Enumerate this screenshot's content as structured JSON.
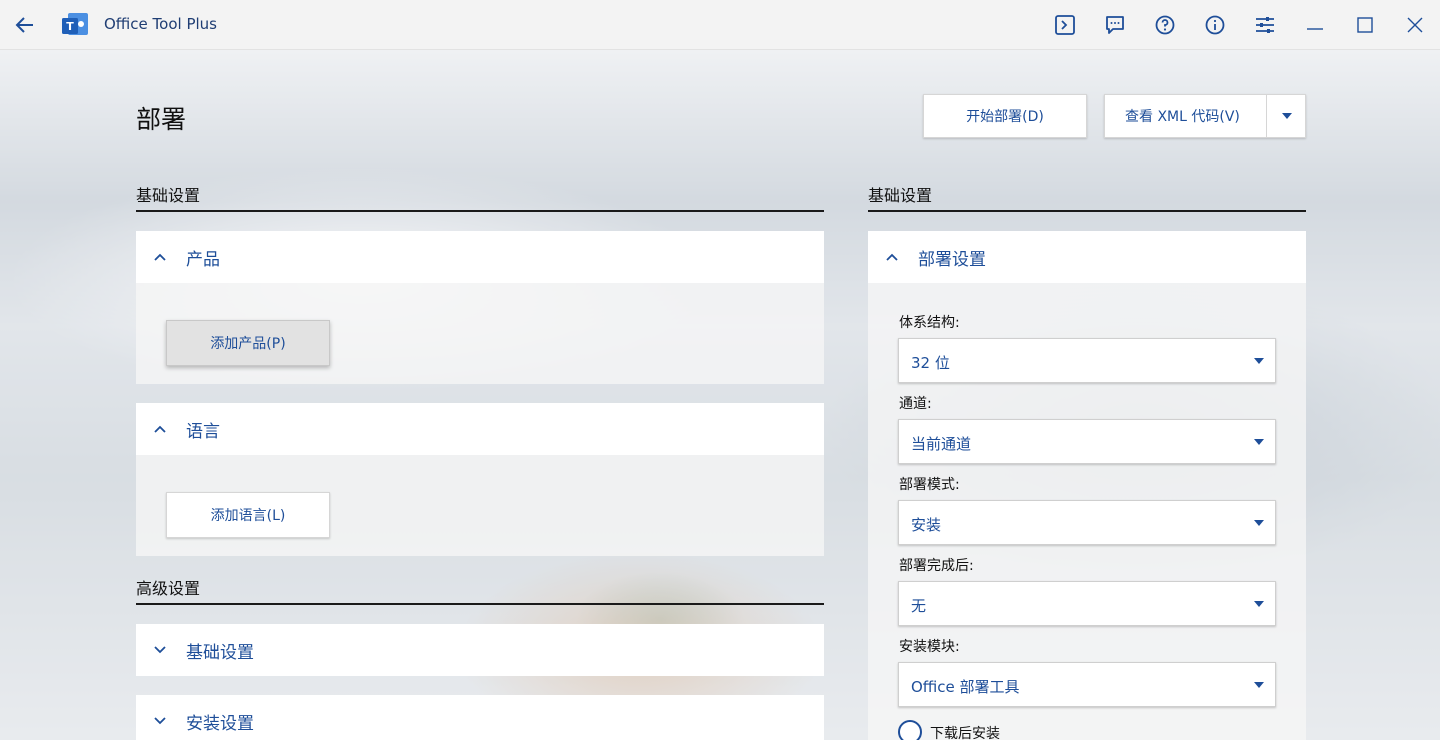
{
  "app": {
    "title": "Office Tool Plus"
  },
  "page": {
    "title": "部署"
  },
  "toolbar": {
    "start_deploy": "开始部署(D)",
    "view_xml": "查看 XML 代码(V)"
  },
  "left": {
    "basic_section": "基础设置",
    "advanced_section": "高级设置",
    "product_panel": {
      "title": "产品",
      "add_button": "添加产品(P)"
    },
    "language_panel": {
      "title": "语言",
      "add_button": "添加语言(L)"
    },
    "advanced_panels": [
      "基础设置",
      "安装设置"
    ]
  },
  "right": {
    "section": "基础设置",
    "panel_title": "部署设置",
    "fields": [
      {
        "label": "体系结构:",
        "value": "32 位"
      },
      {
        "label": "通道:",
        "value": "当前通道"
      },
      {
        "label": "部署模式:",
        "value": "安装"
      },
      {
        "label": "部署完成后:",
        "value": "无"
      },
      {
        "label": "安装模块:",
        "value": "Office 部署工具"
      }
    ],
    "radio_label": "下载后安装"
  },
  "colors": {
    "accent": "#1e4e99",
    "titlebar": "#f3f3f3"
  },
  "icons": {
    "back": "arrow-left-icon",
    "logo": "office-tool-plus-logo-icon",
    "console": "terminal-icon",
    "feedback": "chat-icon",
    "help": "question-icon",
    "info": "info-icon",
    "settings": "sliders-icon",
    "minimize": "minimize-icon",
    "maximize": "maximize-icon",
    "close": "close-icon"
  }
}
